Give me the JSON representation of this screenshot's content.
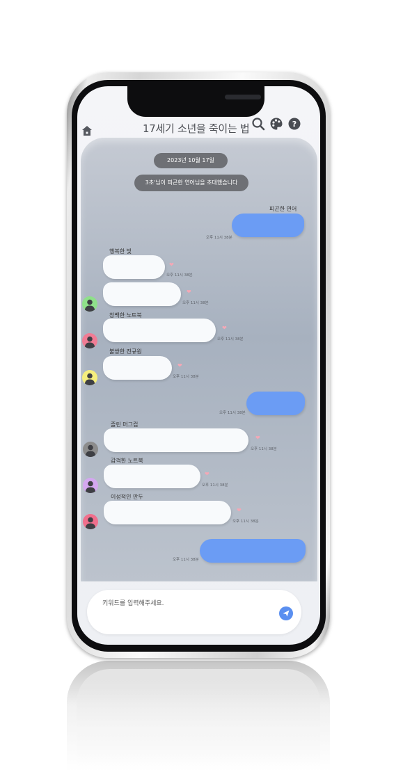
{
  "header": {
    "title": "17세기 소년을 죽이는 법",
    "icons": [
      "home-icon",
      "search-icon",
      "palette-icon",
      "help-icon"
    ]
  },
  "chat": {
    "date_label": "2023년 10월 17일",
    "system_notice": "3초'님이 피곤한 연어님을 초대했습니다",
    "my_name": "피곤한 연어",
    "messages": [
      {
        "kind": "sent",
        "time": "오후 11시 38분"
      },
      {
        "kind": "received",
        "sender": "행복한 빛",
        "time": "오후 11시 38분"
      },
      {
        "kind": "received",
        "sender": "",
        "time": "오후 11시 38분"
      },
      {
        "kind": "received",
        "sender": "창백한 노트북",
        "time": "오후 11시 38분"
      },
      {
        "kind": "received",
        "sender": "불쌍한 진규원",
        "time": "오후 11시 38분"
      },
      {
        "kind": "sent",
        "time": "오후 11시 38분"
      },
      {
        "kind": "received",
        "sender": "졸린 머그컵",
        "time": "오후 11시 38분"
      },
      {
        "kind": "received",
        "sender": "감격한 노트북",
        "time": "오후 11시 38분"
      },
      {
        "kind": "received",
        "sender": "이성적인 만두",
        "time": "오후 11시 38분"
      },
      {
        "kind": "sent",
        "time": "오후 11시 38분"
      }
    ],
    "avatar_colors": [
      "#8fe08a",
      "#f07c94",
      "#f5ee7e",
      "#8c8c8c",
      "#d4a7f0",
      "#f06f8c"
    ],
    "sent_bubble_color": "#6b9cf4"
  },
  "input": {
    "placeholder": "키워드를 입력해주세요.",
    "send_icon": "send-icon"
  }
}
